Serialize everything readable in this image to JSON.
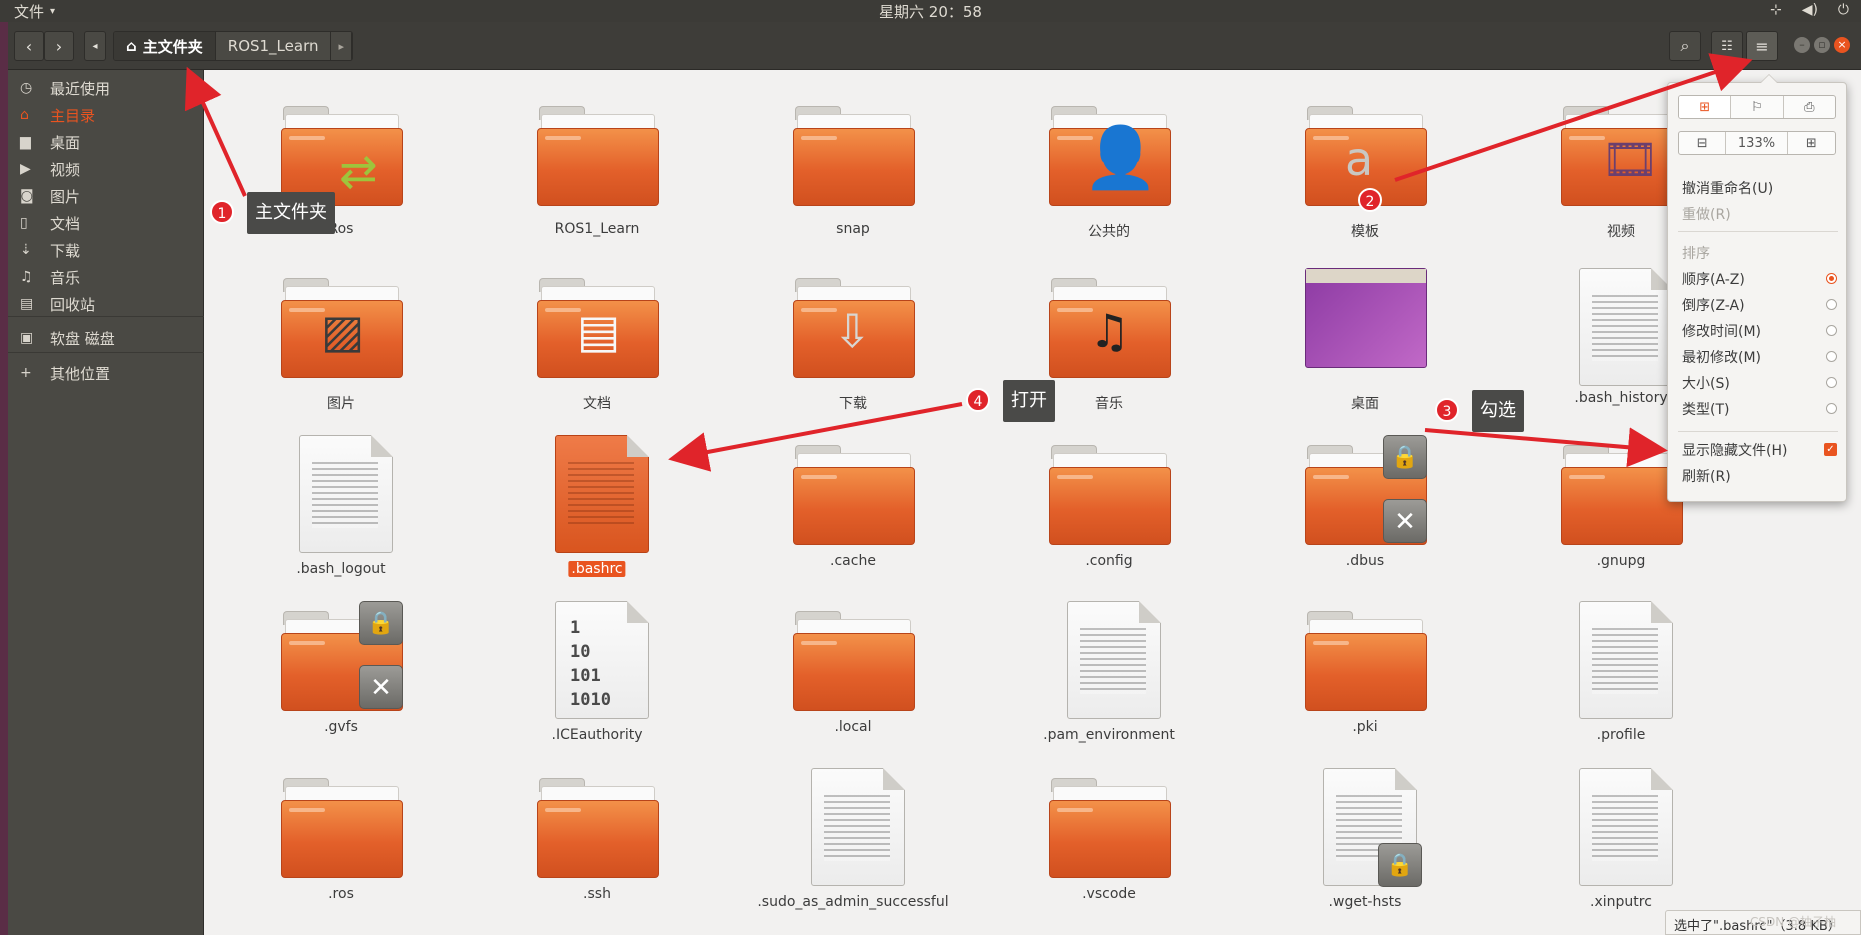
{
  "topbar": {
    "app_menu_label": "文件",
    "clock": "星期六 20：58",
    "tray_icons": [
      "network-icon",
      "volume-icon",
      "power-icon"
    ]
  },
  "header": {
    "back_icon": "chevron-left-icon",
    "forward_icon": "chevron-right-icon",
    "path": [
      {
        "label": "主文件夹",
        "icon": "home-icon",
        "current": true
      },
      {
        "label": "ROS1_Learn",
        "current": false
      }
    ],
    "search_icon": "search-icon",
    "view_icon": "list-view-icon",
    "menu_icon": "hamburger-menu-icon"
  },
  "sidebar": {
    "items": [
      {
        "label": "最近使用",
        "icon": "clock-icon",
        "glyph": "◷",
        "active": false
      },
      {
        "label": "主目录",
        "icon": "home-icon",
        "glyph": "⌂",
        "active": true
      },
      {
        "label": "桌面",
        "icon": "desktop-folder-icon",
        "glyph": "▆",
        "active": false
      },
      {
        "label": "视频",
        "icon": "video-icon",
        "glyph": "▶",
        "active": false
      },
      {
        "label": "图片",
        "icon": "camera-icon",
        "glyph": "◙",
        "active": false
      },
      {
        "label": "文档",
        "icon": "document-icon",
        "glyph": "▯",
        "active": false
      },
      {
        "label": "下载",
        "icon": "download-icon",
        "glyph": "⇣",
        "active": false
      },
      {
        "label": "音乐",
        "icon": "music-icon",
        "glyph": "♫",
        "active": false
      },
      {
        "label": "回收站",
        "icon": "trash-icon",
        "glyph": "▤",
        "active": false
      },
      {
        "label": "软盘 磁盘",
        "icon": "disk-icon",
        "glyph": "▣",
        "active": false
      },
      {
        "label": "其他位置",
        "icon": "plus-icon",
        "glyph": "+",
        "active": false
      }
    ]
  },
  "files": [
    {
      "name": "Ros",
      "type": "folder",
      "emblem": "link"
    },
    {
      "name": "ROS1_Learn",
      "type": "folder"
    },
    {
      "name": "snap",
      "type": "folder"
    },
    {
      "name": "公共的",
      "type": "folder",
      "emblem": "person"
    },
    {
      "name": "模板",
      "type": "folder",
      "emblem": "template"
    },
    {
      "name": "视频",
      "type": "folder",
      "emblem": "film"
    },
    {
      "name": "图片",
      "type": "folder",
      "emblem": "photo"
    },
    {
      "name": "文档",
      "type": "folder",
      "emblem": "doc"
    },
    {
      "name": "下载",
      "type": "folder",
      "emblem": "download"
    },
    {
      "name": "音乐",
      "type": "folder",
      "emblem": "music"
    },
    {
      "name": "桌面",
      "type": "desktop"
    },
    {
      "name": ".bash_history",
      "type": "text"
    },
    {
      "name": ".bash_logout",
      "type": "text"
    },
    {
      "name": ".bashrc",
      "type": "text",
      "selected": true
    },
    {
      "name": ".cache",
      "type": "folder"
    },
    {
      "name": ".config",
      "type": "folder"
    },
    {
      "name": ".dbus",
      "type": "folder",
      "emblem": "locked"
    },
    {
      "name": ".gnupg",
      "type": "folder"
    },
    {
      "name": ".gvfs",
      "type": "folder",
      "emblem": "locked"
    },
    {
      "name": ".ICEauthority",
      "type": "binary",
      "preview": "1\n10\n101\n1010"
    },
    {
      "name": ".local",
      "type": "folder"
    },
    {
      "name": ".pam_environment",
      "type": "text"
    },
    {
      "name": ".pki",
      "type": "folder"
    },
    {
      "name": ".profile",
      "type": "text"
    },
    {
      "name": ".ros",
      "type": "folder"
    },
    {
      "name": ".ssh",
      "type": "folder"
    },
    {
      "name": ".sudo_as_admin_successful",
      "type": "text"
    },
    {
      "name": ".vscode",
      "type": "folder"
    },
    {
      "name": ".wget-hsts",
      "type": "text",
      "emblem": "lock"
    },
    {
      "name": ".xinputrc",
      "type": "text"
    }
  ],
  "menu": {
    "top_buttons": [
      {
        "icon": "new-folder-icon",
        "active": true
      },
      {
        "icon": "bookmark-icon",
        "active": false
      },
      {
        "icon": "open-terminal-icon",
        "active": false
      }
    ],
    "zoom": {
      "minus_icon": "zoom-out-icon",
      "value": "133%",
      "plus_icon": "zoom-in-icon"
    },
    "undo": "撤消重命名(U)",
    "redo": "重做(R)",
    "sort_header": "排序",
    "sort_options": [
      {
        "label": "顺序(A-Z)",
        "selected": true
      },
      {
        "label": "倒序(Z-A)",
        "selected": false
      },
      {
        "label": "修改时间(M)",
        "selected": false
      },
      {
        "label": "最初修改(M)",
        "selected": false
      },
      {
        "label": "大小(S)",
        "selected": false
      },
      {
        "label": "类型(T)",
        "selected": false
      }
    ],
    "show_hidden": {
      "label": "显示隐藏文件(H)",
      "checked": true
    },
    "refresh": "刷新(R)"
  },
  "status": "选中了\".bashrc\"（3.8 KB）",
  "watermark": "CSDN @柚子柚",
  "annotations": [
    {
      "num": "1",
      "text": "主文件夹"
    },
    {
      "num": "2",
      "text": ""
    },
    {
      "num": "3",
      "text": "勾选"
    },
    {
      "num": "4",
      "text": "打开"
    }
  ],
  "colors": {
    "accent": "#e95420",
    "annotation_red": "#e0242a"
  }
}
